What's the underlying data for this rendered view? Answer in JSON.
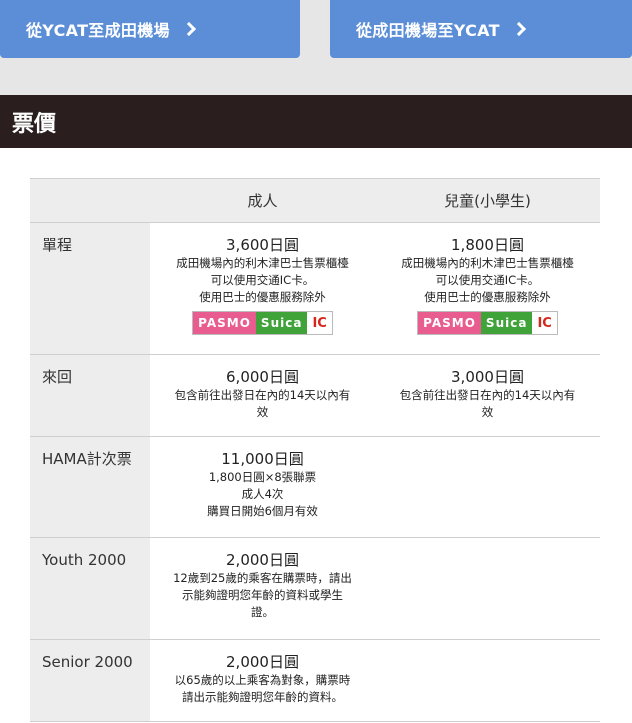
{
  "route_buttons": {
    "to_airport": "從YCAT至成田機場",
    "from_airport": "從成田機場至YCAT"
  },
  "section": {
    "title": "票價"
  },
  "table": {
    "headers": {
      "adult": "成人",
      "child": "兒童(小學生)"
    },
    "rows": [
      {
        "label": "單程",
        "adult": {
          "price": "3,600日圓",
          "notes": [
            "成田機場內的利木津巴士售票櫃檯",
            "可以使用交通IC卡。",
            "使用巴士的優惠服務除外"
          ]
        },
        "child": {
          "price": "1,800日圓",
          "notes": [
            "成田機場內的利木津巴士售票櫃檯",
            "可以使用交通IC卡。",
            "使用巴士的優惠服務除外"
          ]
        },
        "ic_logo": {
          "pasmo": "PASMO",
          "suica": "Suica",
          "ic": "IC"
        }
      },
      {
        "label": "來回",
        "adult": {
          "price": "6,000日圓",
          "notes": [
            "包含前往出發日在內的14天以內有",
            "效"
          ]
        },
        "child": {
          "price": "3,000日圓",
          "notes": [
            "包含前往出發日在內的14天以內有",
            "效"
          ]
        }
      },
      {
        "label": "HAMA計次票",
        "adult": {
          "price": "11,000日圓",
          "notes": [
            "1,800日圓×8張聯票",
            "成人4次",
            "購買日開始6個月有效"
          ]
        }
      },
      {
        "label": "Youth 2000",
        "adult": {
          "price": "2,000日圓",
          "notes": [
            "12歲到25歲的乘客在購票時，請出",
            "示能夠證明您年齡的資料或學生",
            "證。"
          ]
        }
      },
      {
        "label": "Senior 2000",
        "adult": {
          "price": "2,000日圓",
          "notes": [
            "以65歲的以上乘客為對象，購票時",
            "請出示能夠證明您年齡的資料。"
          ]
        }
      }
    ]
  },
  "colors": {
    "button_blue": "#5b8ed6",
    "section_dark": "#2a1f1e",
    "label_gray": "#ededed"
  }
}
